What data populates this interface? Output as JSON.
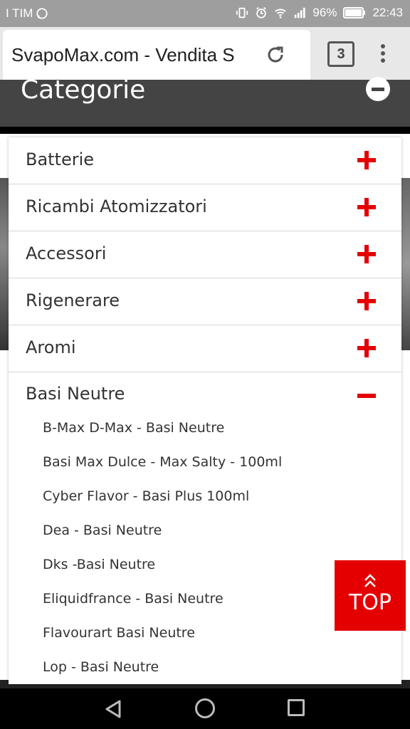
{
  "status_bar": {
    "carrier": "I TIM",
    "battery": "96%",
    "time": "22:43"
  },
  "browser": {
    "url_title": "SvapoMax.com - Vendita S",
    "tab_count": "3"
  },
  "page": {
    "categories_title": "Categorie"
  },
  "menu": {
    "items": [
      {
        "label": "Batterie"
      },
      {
        "label": "Ricambi Atomizzatori"
      },
      {
        "label": "Accessori"
      },
      {
        "label": "Rigenerare"
      },
      {
        "label": "Aromi"
      },
      {
        "label": "Basi Neutre"
      }
    ],
    "subitems": [
      "B-Max D-Max - Basi Neutre",
      "Basi Max Dulce - Max Salty - 100ml",
      "Cyber Flavor - Basi Plus 100ml",
      "Dea - Basi Neutre",
      "Dks -Basi Neutre",
      "Eliquidfrance - Basi Neutre",
      "Flavourart Basi Neutre",
      "Lop - Basi Neutre"
    ]
  },
  "top_button": {
    "label": "TOP"
  },
  "colors": {
    "accent_red": "#e40000",
    "header_dark": "#444444",
    "status_bar": "#9e9e9e"
  }
}
